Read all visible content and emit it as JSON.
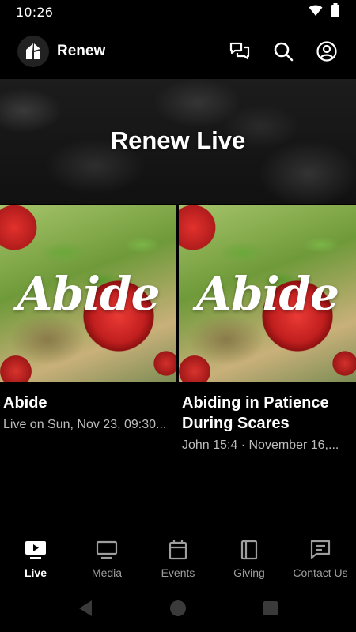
{
  "status_bar": {
    "time": "10:26"
  },
  "app_bar": {
    "title": "Renew"
  },
  "banner": {
    "title": "Renew Live"
  },
  "cards": [
    {
      "thumb_text": "Abide",
      "title": "Abide",
      "subtitle": "Live on Sun, Nov 23, 09:30..."
    },
    {
      "thumb_text": "Abide",
      "title": "Abiding in Patience During Scares",
      "subtitle": "John 15:4 · November 16,..."
    }
  ],
  "bottom_nav": {
    "items": [
      {
        "label": "Live",
        "icon": "live-tv-icon",
        "active": true
      },
      {
        "label": "Media",
        "icon": "monitor-icon",
        "active": false
      },
      {
        "label": "Events",
        "icon": "calendar-icon",
        "active": false
      },
      {
        "label": "Giving",
        "icon": "book-icon",
        "active": false
      },
      {
        "label": "Contact Us",
        "icon": "message-icon",
        "active": false
      }
    ]
  },
  "colors": {
    "background": "#000000",
    "text": "#ffffff",
    "muted": "#bdbdbd",
    "nav_inactive": "#9e9e9e"
  }
}
